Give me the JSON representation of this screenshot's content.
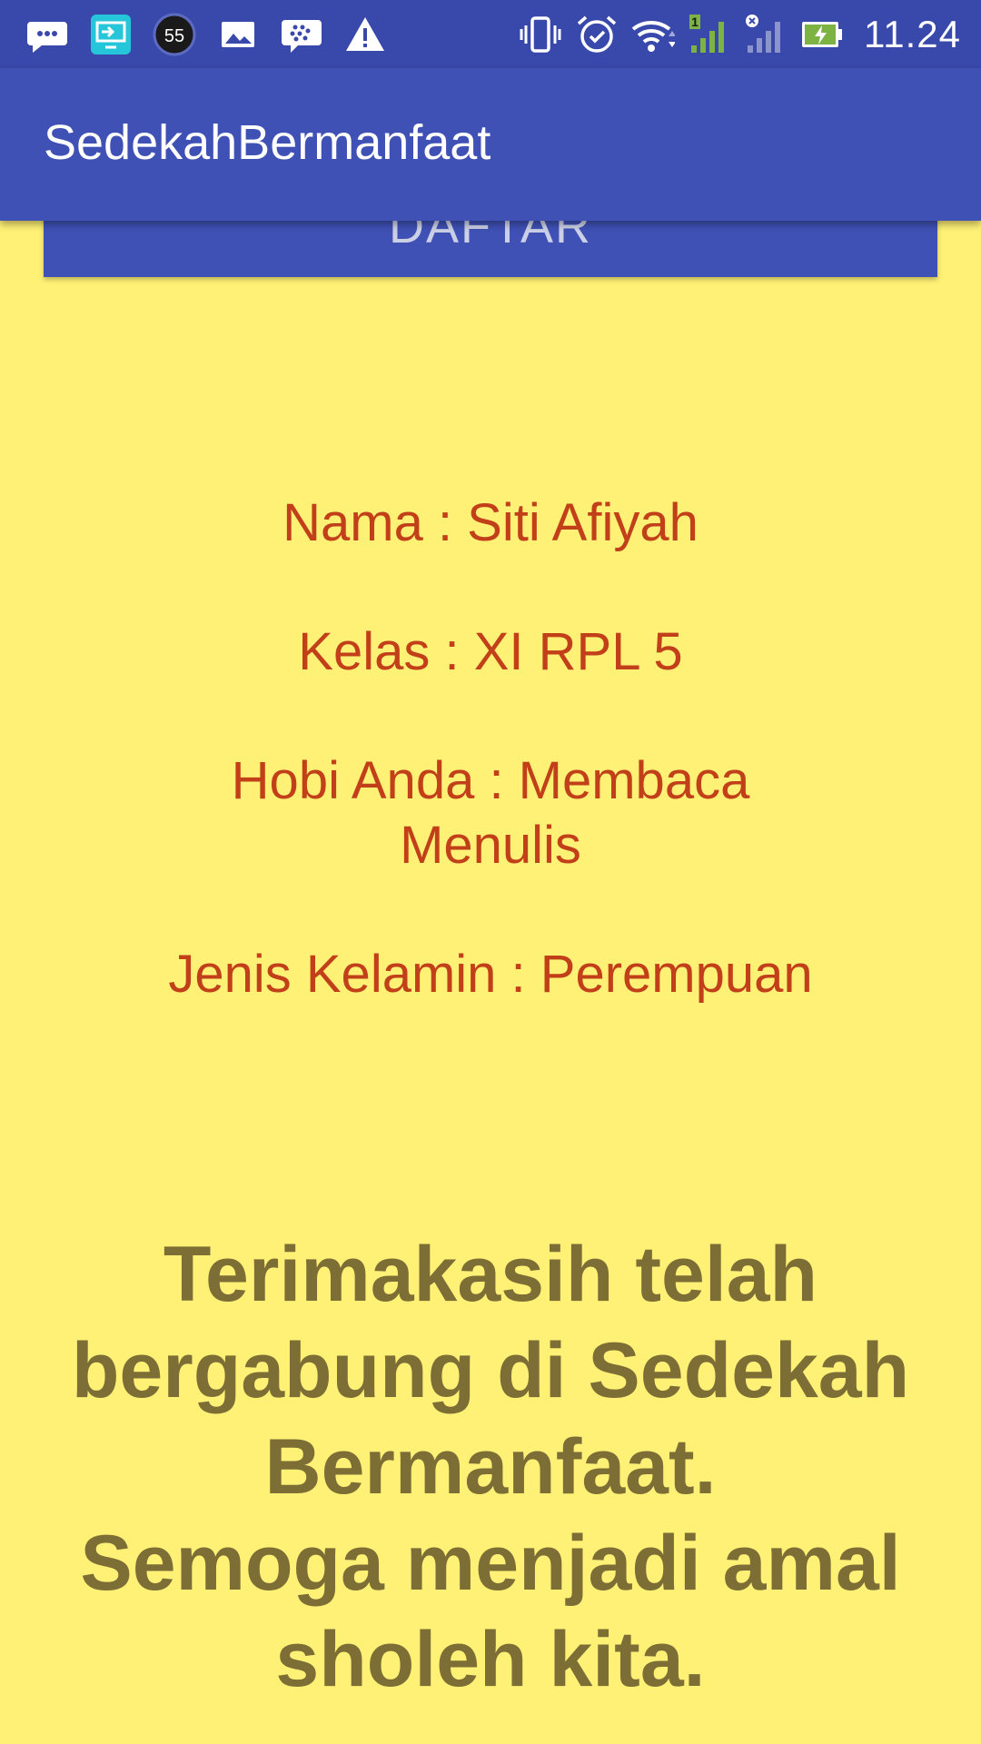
{
  "status_bar": {
    "time": "11.24",
    "badge_count": "55",
    "signal_sim_label": "1",
    "icons": [
      "messages-icon",
      "screen-share-icon",
      "counter-badge-icon",
      "gallery-icon",
      "bbm-icon",
      "warning-icon",
      "vibrate-icon",
      "alarm-icon",
      "wifi-icon",
      "signal-icon",
      "no-signal-icon",
      "battery-charging-icon"
    ]
  },
  "app_bar": {
    "title": "SedekahBermanfaat"
  },
  "register_button": {
    "label": "DAFTAR"
  },
  "info": {
    "name": "Nama : Siti Afiyah",
    "class": "Kelas : XI RPL 5",
    "hobby": "Hobi Anda : Membaca Menulis",
    "gender": "Jenis Kelamin : Perempuan"
  },
  "thanks": {
    "line1": "Terimakasih telah bergabung di Sedekah Bermanfaat.",
    "line2": "Semoga menjadi amal sholeh kita."
  },
  "colors": {
    "background": "#fff176",
    "primary": "#3f51b5",
    "status_bar": "#3949ab",
    "info_text": "#c1401a",
    "thanks_text": "#7c6e35"
  }
}
